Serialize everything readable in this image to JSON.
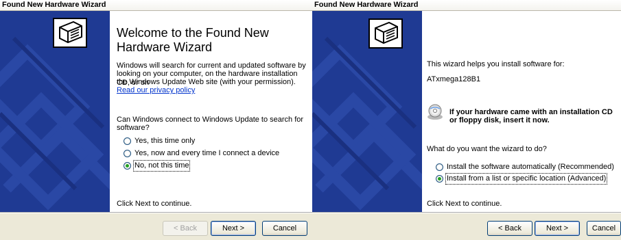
{
  "left": {
    "title": "Found New Hardware Wizard",
    "heading_line1": "Welcome to the Found New",
    "heading_line2": "Hardware Wizard",
    "intro1": "Windows will search for current and updated software by",
    "intro2": "looking on your computer, on the hardware installation CD, or on",
    "intro3": "the Windows Update Web site (with your permission).",
    "privacy_link": "Read our privacy policy",
    "question1": "Can Windows connect to Windows Update to search for",
    "question2": "software?",
    "options": [
      "Yes, this time only",
      "Yes, now and every time I connect a device",
      "No, not this time"
    ],
    "selected_option": 2,
    "footer": "Click Next to continue.",
    "back": "< Back",
    "next": "Next >",
    "cancel": "Cancel"
  },
  "right": {
    "title": "Found New Hardware Wizard",
    "intro": "This wizard helps you install software for:",
    "device": "ATxmega128B1",
    "cd_line1": "If your hardware came with an installation CD",
    "cd_line2": "or floppy disk, insert it now.",
    "question": "What do you want the wizard to do?",
    "options": [
      "Install the software automatically (Recommended)",
      "Install from a list or specific location (Advanced)"
    ],
    "selected_option": 1,
    "footer": "Click Next to continue.",
    "back": "< Back",
    "next": "Next >",
    "cancel": "Cancel"
  },
  "icons": {
    "hardware_icon": "hardware-box-icon",
    "cd_icon": "cd-disk-icon"
  }
}
